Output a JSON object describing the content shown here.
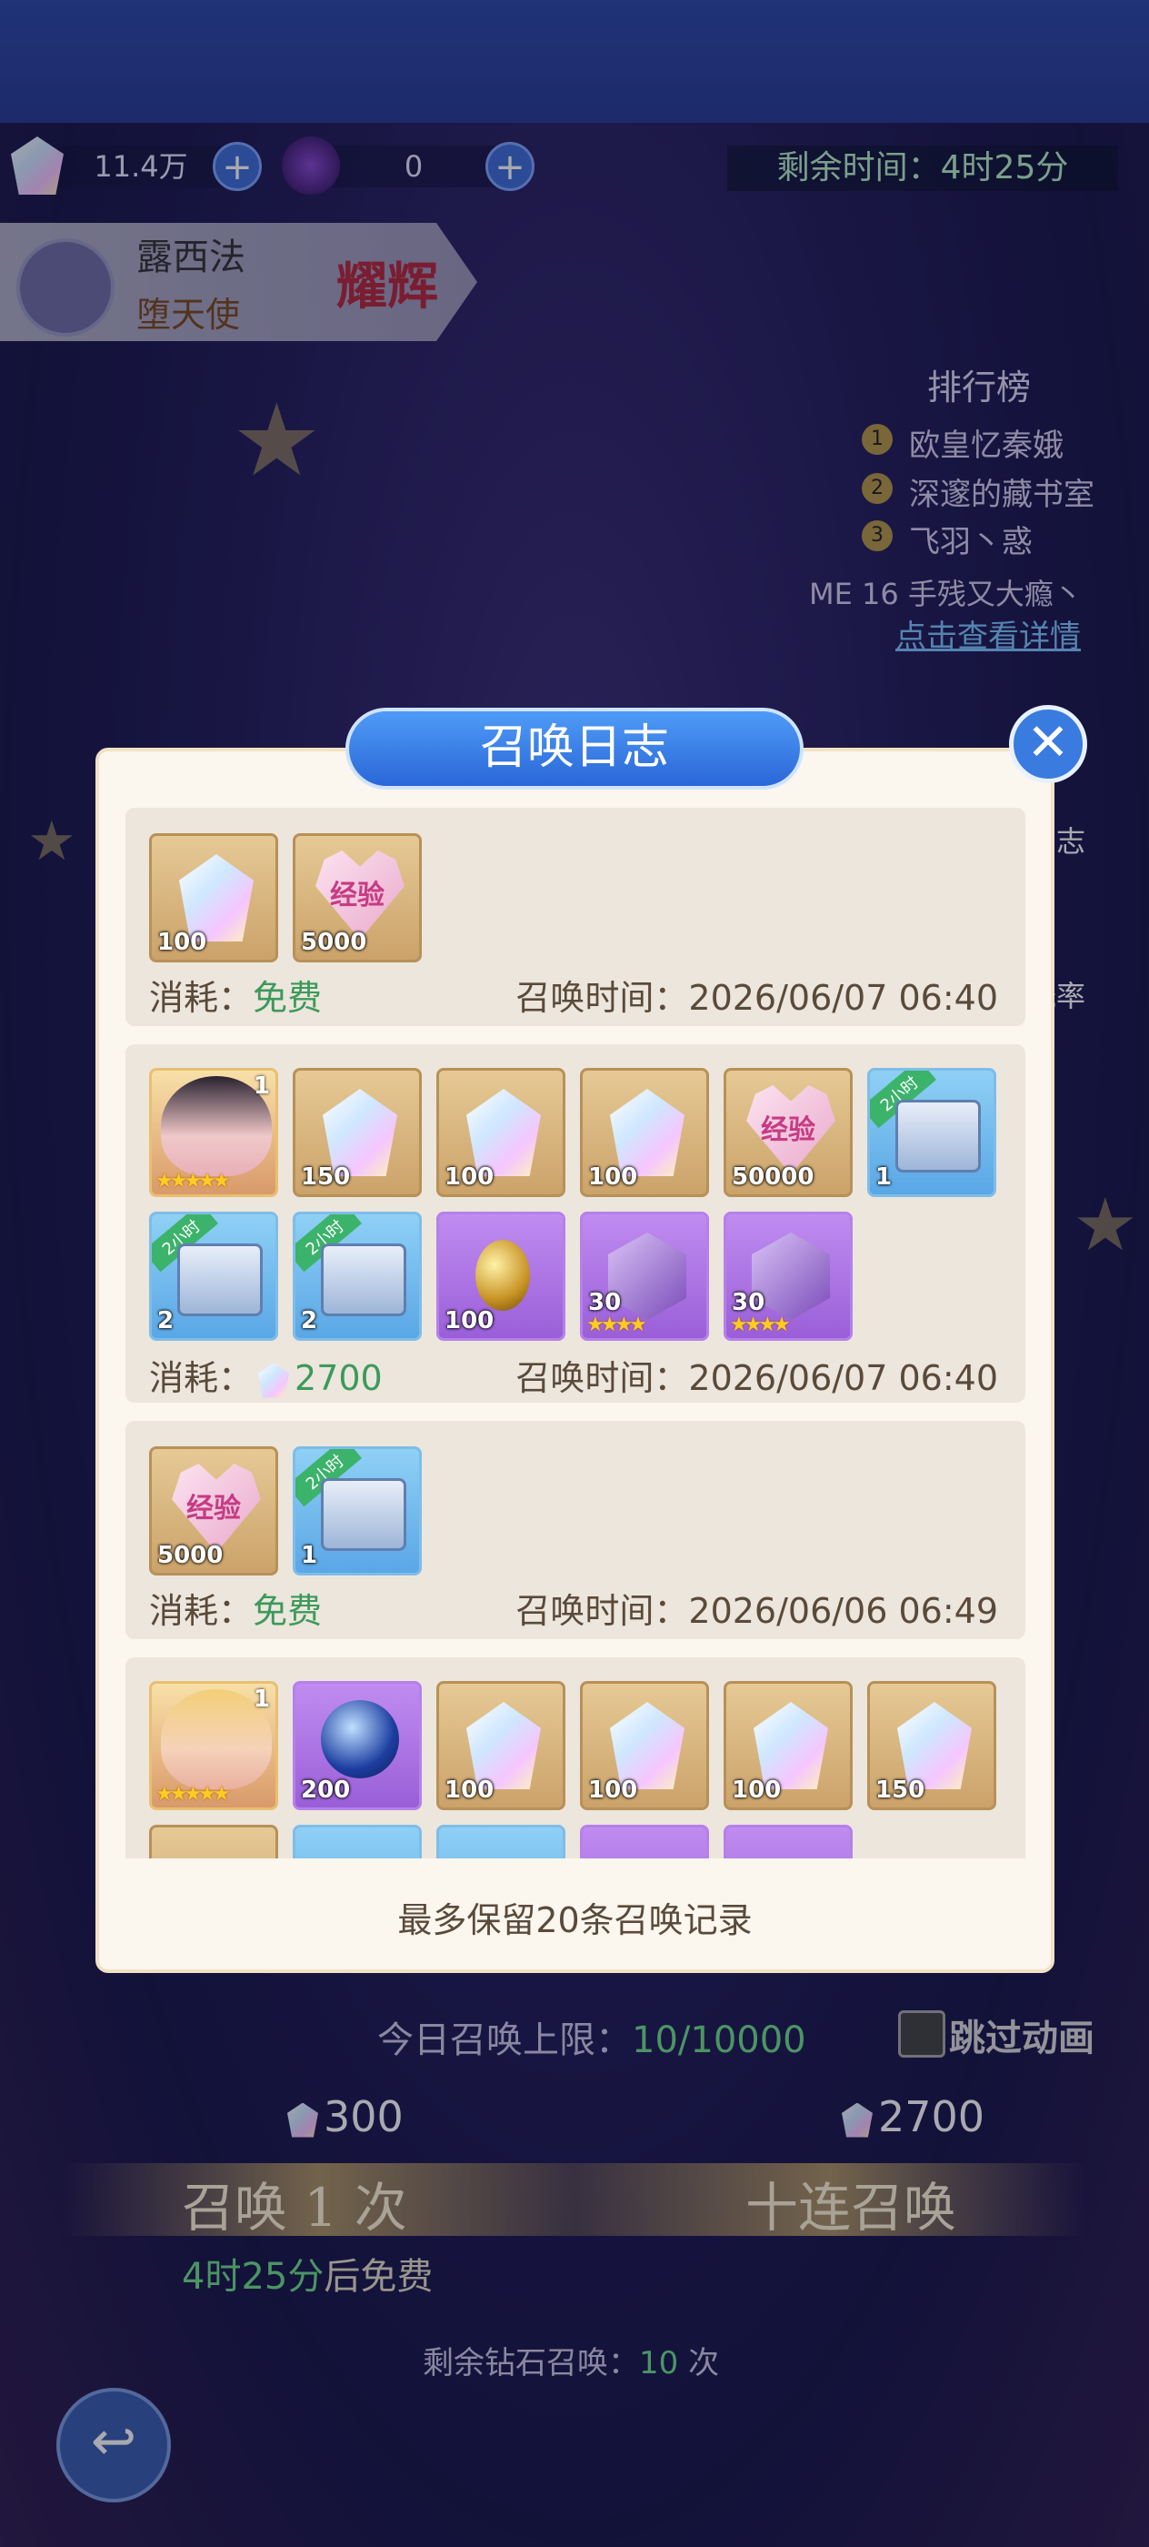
{
  "top_bar": {
    "diamonds": "11.4万",
    "crystals": "0",
    "timer_label": "剩余时间：4时25分"
  },
  "hero": {
    "name": "露西法",
    "title": "堕天使",
    "badge": "耀辉"
  },
  "ranking": {
    "title": "排行榜",
    "items": [
      {
        "rank": "1",
        "name": "欧皇忆秦娥"
      },
      {
        "rank": "2",
        "name": "深邃的藏书室"
      },
      {
        "rank": "3",
        "name": "飞羽丶惑"
      }
    ],
    "me": "ME 16  手残又大瘾丶",
    "link": "点击查看详情"
  },
  "side": {
    "log": "日志",
    "rate": "概率"
  },
  "modal": {
    "title": "召唤日志",
    "close": "✕",
    "entries": [
      {
        "items": [
          {
            "kind": "crystal",
            "qty": "100"
          },
          {
            "kind": "exp",
            "qty": "5000",
            "label": "经验"
          }
        ],
        "cost_label": "消耗：",
        "cost": "免费",
        "time_label": "召唤时间：",
        "time": "2026/06/07 06:40"
      },
      {
        "items": [
          {
            "kind": "hero",
            "qty": "1",
            "stars": "★★★★★"
          },
          {
            "kind": "crystal",
            "qty": "150"
          },
          {
            "kind": "crystal",
            "qty": "100"
          },
          {
            "kind": "crystal",
            "qty": "100"
          },
          {
            "kind": "exp",
            "qty": "50000",
            "label": "经验"
          },
          {
            "kind": "chest",
            "qty": "1",
            "tag": "2小时"
          },
          {
            "kind": "chest-gold",
            "qty": "2",
            "tag": "2小时"
          },
          {
            "kind": "chest-gold",
            "qty": "2",
            "tag": "2小时"
          },
          {
            "kind": "egg",
            "qty": "100"
          },
          {
            "kind": "box",
            "qty": "30",
            "stars": "★★★★"
          },
          {
            "kind": "box",
            "qty": "30",
            "stars": "★★★★"
          }
        ],
        "cost_label": "消耗：",
        "cost": "2700",
        "time_label": "召唤时间：",
        "time": "2026/06/07 06:40"
      },
      {
        "items": [
          {
            "kind": "exp",
            "qty": "5000",
            "label": "经验"
          },
          {
            "kind": "chest",
            "qty": "1",
            "tag": "2小时"
          }
        ],
        "cost_label": "消耗：",
        "cost": "免费",
        "time_label": "召唤时间：",
        "time": "2026/06/06 06:49"
      },
      {
        "items": [
          {
            "kind": "hero2",
            "qty": "1",
            "stars": "★★★★★"
          },
          {
            "kind": "orb",
            "qty": "200"
          },
          {
            "kind": "crystal",
            "qty": "100"
          },
          {
            "kind": "crystal",
            "qty": "100"
          },
          {
            "kind": "crystal",
            "qty": "100"
          },
          {
            "kind": "crystal",
            "qty": "150"
          }
        ]
      }
    ],
    "footer": "最多保留20条召唤记录"
  },
  "summon": {
    "limit_label": "今日召唤上限：",
    "limit_value": "10/10000",
    "skip": "跳过动画",
    "cost_once": "300",
    "cost_ten": "2700",
    "btn_once": "召唤 1 次",
    "btn_ten": "十连召唤",
    "free_time": "4时25分",
    "free_suffix": "后免费",
    "remain_label": "剩余钻石召唤：",
    "remain_value": "10",
    "remain_unit": "次"
  },
  "colors": {
    "accent": "#2a67d8",
    "free": "#3c9a5a",
    "modal_bg": "#fbf6ee"
  }
}
